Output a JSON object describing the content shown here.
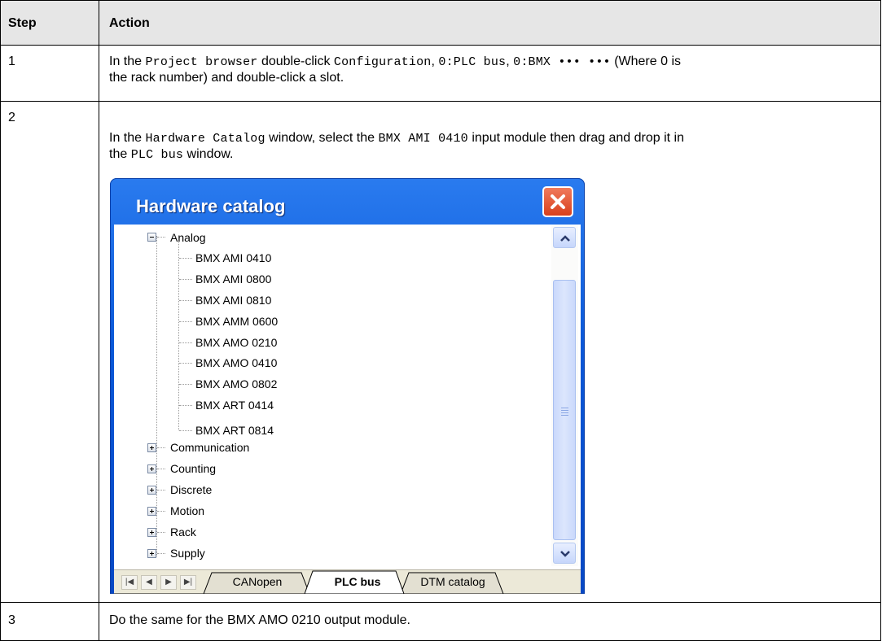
{
  "table": {
    "header": {
      "step": "Step",
      "action": "Action"
    },
    "rows": [
      {
        "step": "1",
        "action": {
          "in_the": "In the ",
          "project_browser": "Project browser",
          "double_click": " double-click ",
          "configuration": "Configuration",
          "comma1": ", ",
          "plc_bus_path": "0:PLC bus",
          "comma2": ", ",
          "bmx_path": "0:BMX ••• •••",
          "where": " (Where 0 is",
          "line2": "the rack number) and double-click a slot."
        }
      },
      {
        "step": "2",
        "action": {
          "in_the": "In the ",
          "hardware_catalog": "Hardware Catalog",
          "window_select": " window, select the ",
          "bmx_ami": "BMX AMI 0410",
          "input_module": " input module then drag and drop it in",
          "the": "the ",
          "plc_bus": "PLC bus",
          "window": " window."
        }
      },
      {
        "step": "3",
        "action": "Do the same for the BMX AMO 0210 output module."
      }
    ]
  },
  "hardware_catalog": {
    "title": "Hardware catalog",
    "analog_label": "Analog",
    "analog_items": [
      "BMX AMI 0410",
      "BMX AMI 0800",
      "BMX AMI 0810",
      "BMX AMM 0600",
      "BMX AMO 0210",
      "BMX AMO 0410",
      "BMX AMO 0802",
      "BMX ART 0414",
      "BMX ART 0814"
    ],
    "groups": [
      "Communication",
      "Counting",
      "Discrete",
      "Motion",
      "Rack",
      "Supply"
    ],
    "tabs": [
      "CANopen",
      "PLC bus",
      "DTM catalog"
    ],
    "active_tab": "PLC bus",
    "nav_buttons": [
      "first-icon",
      "prev-icon",
      "next-icon",
      "last-icon"
    ],
    "colors": {
      "titlebar": "#0a58d8",
      "close_button": "#d8401c",
      "scroll_thumb": "#c9d8fb",
      "tab_strip": "#ece9d8"
    }
  }
}
